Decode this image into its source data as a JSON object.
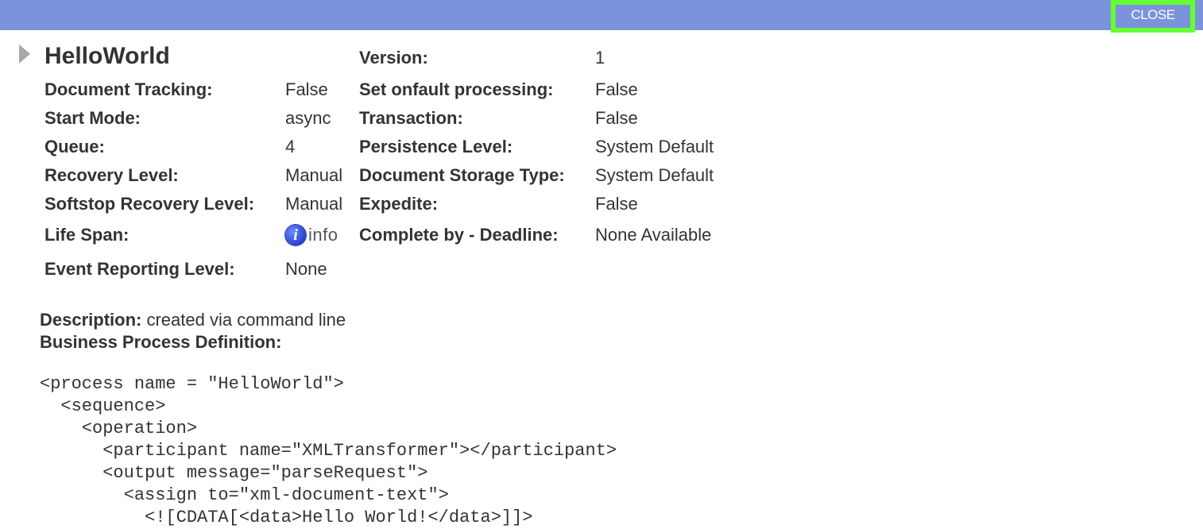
{
  "header": {
    "close_label": "CLOSE"
  },
  "process": {
    "name": "HelloWorld",
    "left_fields": [
      {
        "label": "Document Tracking:",
        "value": "False"
      },
      {
        "label": "Start Mode:",
        "value": "async"
      },
      {
        "label": "Queue:",
        "value": "4"
      },
      {
        "label": "Recovery Level:",
        "value": "Manual"
      },
      {
        "label": "Softstop Recovery Level:",
        "value": "Manual"
      },
      {
        "label": "Life Span:",
        "value": "info"
      },
      {
        "label": "Event Reporting Level:",
        "value": "None"
      }
    ],
    "right_fields": [
      {
        "label": "Version:",
        "value": "1"
      },
      {
        "label": "Set onfault processing:",
        "value": "False"
      },
      {
        "label": "Transaction:",
        "value": "False"
      },
      {
        "label": "Persistence Level:",
        "value": "System Default"
      },
      {
        "label": "Document Storage Type:",
        "value": "System Default"
      },
      {
        "label": "Expedite:",
        "value": "False"
      },
      {
        "label": "Complete by - Deadline:",
        "value": "None Available"
      }
    ]
  },
  "description": {
    "label": "Description:",
    "value": " created via command line",
    "definition_label": "Business Process Definition:"
  },
  "definition_code": "<process name = \"HelloWorld\">\n  <sequence>\n    <operation>\n      <participant name=\"XMLTransformer\"></participant>\n      <output message=\"parseRequest\">\n        <assign to=\"xml-document-text\">\n          <![CDATA[<data>Hello World!</data>]]>",
  "icons": {
    "expand": "triangle-right-icon",
    "info": "info-icon"
  }
}
